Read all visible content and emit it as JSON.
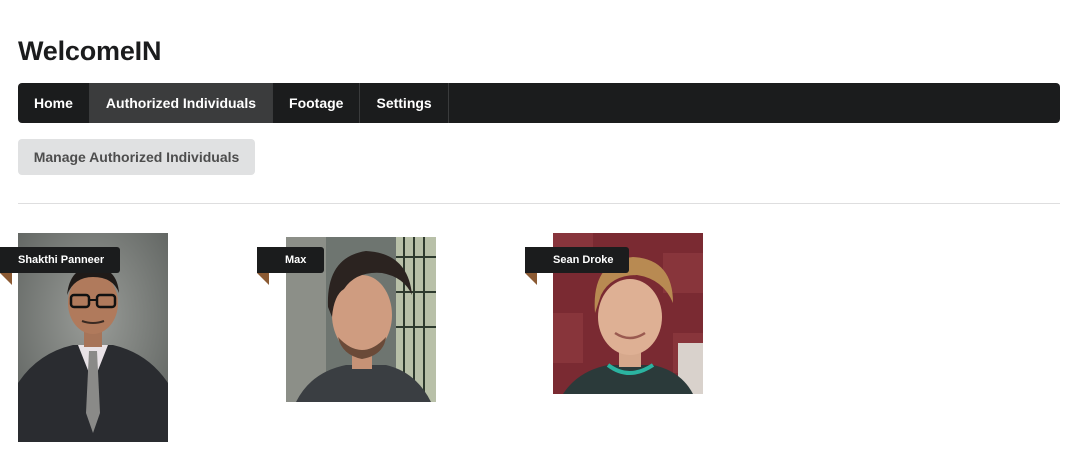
{
  "app": {
    "title": "WelcomeIN"
  },
  "nav": {
    "items": [
      {
        "label": "Home",
        "active": false
      },
      {
        "label": "Authorized Individuals",
        "active": true
      },
      {
        "label": "Footage",
        "active": false
      },
      {
        "label": "Settings",
        "active": false
      }
    ]
  },
  "actions": {
    "manage_label": "Manage Authorized Individuals"
  },
  "individuals": [
    {
      "name": "Shakthi Panneer"
    },
    {
      "name": "Max"
    },
    {
      "name": "Sean Droke"
    }
  ],
  "colors": {
    "navbar_bg": "#1b1c1d",
    "nav_active_bg": "#3b3c3d",
    "button_bg": "#e0e1e2",
    "ribbon_bg": "#1b1c1d",
    "ribbon_fold": "#8b5a33"
  }
}
